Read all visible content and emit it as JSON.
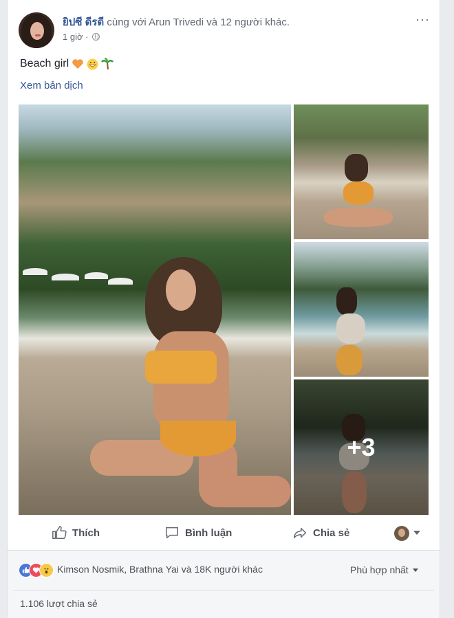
{
  "post": {
    "author": "ยิปซี ดีรดี",
    "with_text": "cùng với Arun Trivedi và 12 người khác.",
    "time": "1 giờ ·",
    "more_label": "···",
    "text": "Beach girl",
    "emojis": [
      "orange-heart-icon",
      "grinning-face-icon",
      "palm-tree-icon"
    ],
    "translate": "Xem bản dịch",
    "more_photos": "+3"
  },
  "actions": {
    "like": "Thích",
    "comment": "Bình luận",
    "share": "Chia sẻ"
  },
  "reactions": {
    "names": "Kimson Nosmik, Brathna Yai và 18K người khác",
    "sort": "Phù hợp nhất"
  },
  "shares": "1.106 lượt chia sẻ",
  "colors": {
    "link": "#365899",
    "like": "#4a77d9",
    "love": "#ef4b5d",
    "wow": "#f7c948"
  }
}
